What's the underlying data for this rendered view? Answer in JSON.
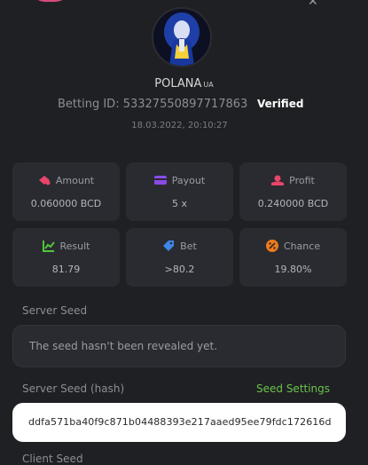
{
  "user": {
    "name": "POLANA",
    "country": "UA",
    "betting_label": "Betting ID:",
    "betting_id": "53327550897717863",
    "verified": "Verified",
    "date": "18.03.2022, 20:10:27"
  },
  "stats": {
    "amount": {
      "label": "Amount",
      "value": "0.060000 BCD",
      "icon": "money-icon",
      "color": "#e8456b"
    },
    "payout": {
      "label": "Payout",
      "value": "5 x",
      "icon": "wallet-icon",
      "color": "#8a4be8"
    },
    "profit": {
      "label": "Profit",
      "value": "0.240000 BCD",
      "icon": "hand-coin-icon",
      "color": "#e8456b"
    },
    "result": {
      "label": "Result",
      "value": "81.79",
      "icon": "chart-icon",
      "color": "#52c43a"
    },
    "bet": {
      "label": "Bet",
      "value": ">80.2",
      "icon": "tag-icon",
      "color": "#3f86e8"
    },
    "chance": {
      "label": "Chance",
      "value": "19.80%",
      "icon": "percent-icon",
      "color": "#f07b1a"
    }
  },
  "server_seed": {
    "label": "Server Seed",
    "value": "The seed hasn't been revealed yet."
  },
  "server_seed_hash": {
    "label": "Server Seed (hash)",
    "settings_link": "Seed Settings",
    "value": "ddfa571ba40f9c871b04488393e217aaed95ee79fdc172616d"
  },
  "client_seed": {
    "label": "Client Seed"
  }
}
